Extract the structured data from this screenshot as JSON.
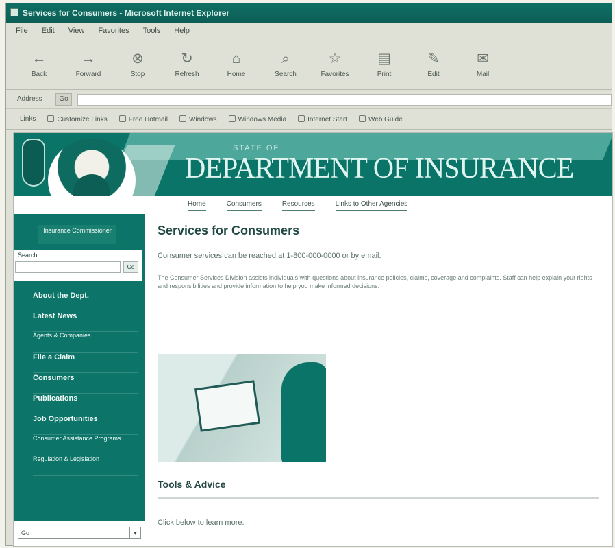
{
  "window": {
    "title": "Services for Consumers - Microsoft Internet Explorer"
  },
  "menu": [
    "File",
    "Edit",
    "View",
    "Favorites",
    "Tools",
    "Help"
  ],
  "toolbar": [
    {
      "label": "Back",
      "icon": "back-icon"
    },
    {
      "label": "Forward",
      "icon": "forward-icon"
    },
    {
      "label": "Stop",
      "icon": "stop-icon"
    },
    {
      "label": "Refresh",
      "icon": "refresh-icon"
    },
    {
      "label": "Home",
      "icon": "home-icon"
    },
    {
      "label": "Search",
      "icon": "search-icon"
    },
    {
      "label": "Favorites",
      "icon": "favorites-icon"
    },
    {
      "label": "Print",
      "icon": "print-icon"
    },
    {
      "label": "Edit",
      "icon": "edit-icon"
    },
    {
      "label": "Mail",
      "icon": "mail-icon"
    }
  ],
  "address": {
    "label": "Address",
    "go": "Go",
    "value": ""
  },
  "links": {
    "label": "Links",
    "items": [
      "Customize Links",
      "Free Hotmail",
      "Windows",
      "Windows Media",
      "Internet Start",
      "Web Guide"
    ]
  },
  "site": {
    "small_title": "STATE OF",
    "title": "DEPARTMENT OF INSURANCE",
    "nav": [
      "Home",
      "Consumers",
      "Resources",
      "Links to Other Agencies"
    ]
  },
  "sidebar": {
    "commissioner": "Insurance Commissioner",
    "search_label": "Search",
    "search_button": "Go",
    "items": [
      {
        "label": "About the Dept.",
        "small": false
      },
      {
        "label": "Latest News",
        "small": false
      },
      {
        "label": "Agents & Companies",
        "small": true
      },
      {
        "label": "File a Claim",
        "small": false
      },
      {
        "label": "Consumers",
        "small": false
      },
      {
        "label": "Publications",
        "small": false
      },
      {
        "label": "Job Opportunities",
        "small": false
      },
      {
        "label": "Consumer Assistance Programs",
        "small": true
      },
      {
        "label": "Regulation & Legislation",
        "small": true
      }
    ],
    "select": "Go"
  },
  "content": {
    "title": "Services for Consumers",
    "intro": "Consumer services can be reached at 1-800-000-0000 or by email.",
    "body": "The Consumer Services Division assists individuals with questions about insurance policies, claims, coverage and complaints. Staff can help explain your rights and responsibilities and provide information to help you make informed decisions.",
    "section_title": "Tools & Advice",
    "footer": "Click below to learn more."
  }
}
